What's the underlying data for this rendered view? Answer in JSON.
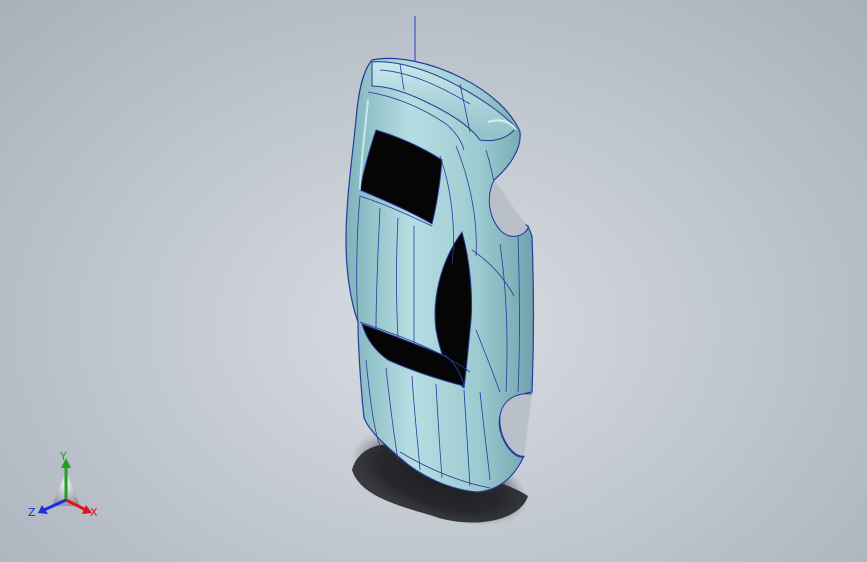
{
  "viewport": {
    "background": "#b7bdc6",
    "model": {
      "name": "car-body",
      "body_color": "#a9d3d8",
      "edge_color": "#2a3a9a",
      "glass_color": "#050505",
      "shadow_color": "#1e1f22"
    }
  },
  "triad": {
    "x_label": "X",
    "y_label": "Y",
    "z_label": "Z",
    "colors": {
      "x": "#e0141e",
      "y": "#1fa31f",
      "z": "#1a2fd6"
    }
  }
}
